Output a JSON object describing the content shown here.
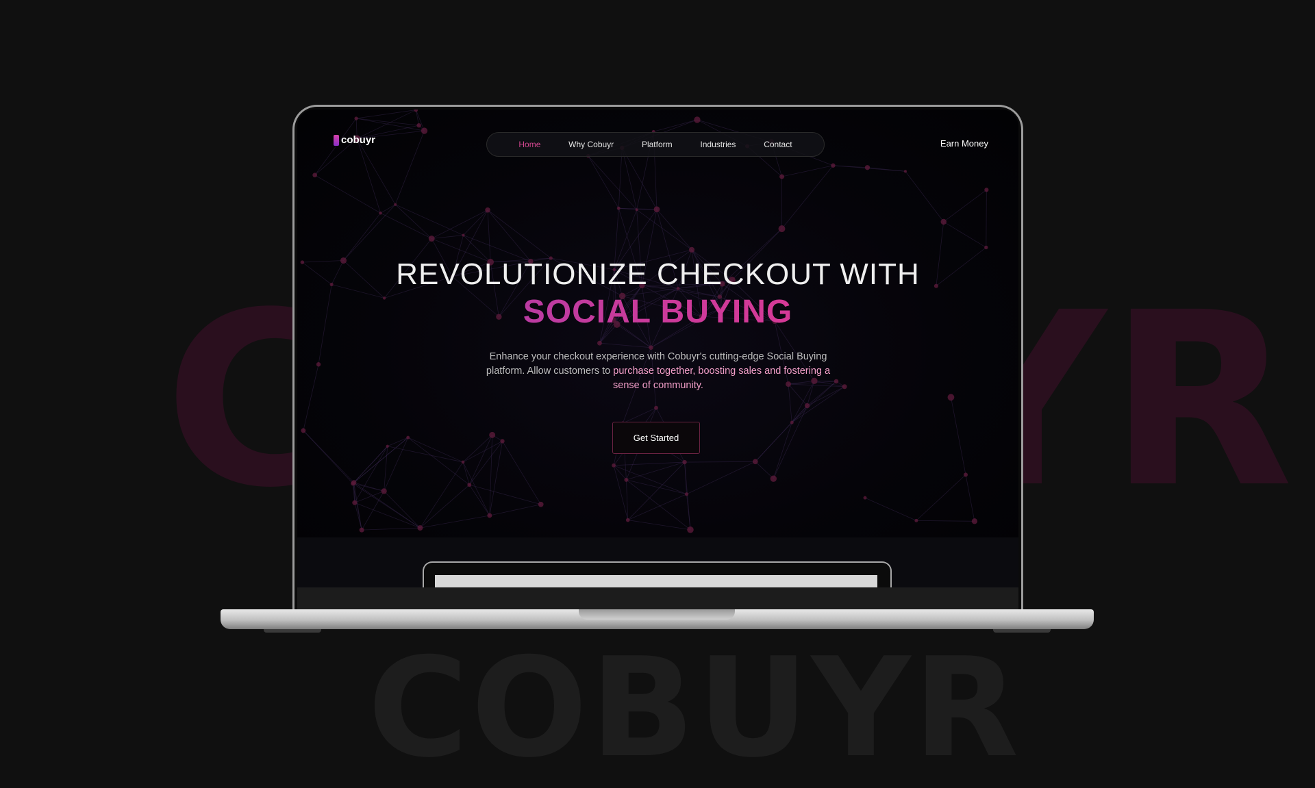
{
  "background": {
    "word_top": "COBUYR",
    "word_bottom": "COBUYR"
  },
  "site": {
    "logo_text": "cobuyr",
    "nav": [
      {
        "label": "Home",
        "active": true
      },
      {
        "label": "Why Cobuyr",
        "active": false
      },
      {
        "label": "Platform",
        "active": false
      },
      {
        "label": "Industries",
        "active": false
      },
      {
        "label": "Contact",
        "active": false
      }
    ],
    "earn_money": "Earn Money",
    "hero": {
      "title_line1": "REVOLUTIONIZE CHECKOUT WITH",
      "title_line2": "SOCIAL BUYING",
      "desc_part1": "Enhance your checkout experience with Cobuyr's cutting-edge Social Buying platform. Allow customers to ",
      "desc_highlight": "purchase together, boosting sales and fostering a sense of community.",
      "cta": "Get Started"
    }
  },
  "colors": {
    "accent_pink": "#e73790",
    "accent_purple": "#9b3ab0",
    "nav_active": "#d2468f",
    "page_bg": "#101010"
  }
}
